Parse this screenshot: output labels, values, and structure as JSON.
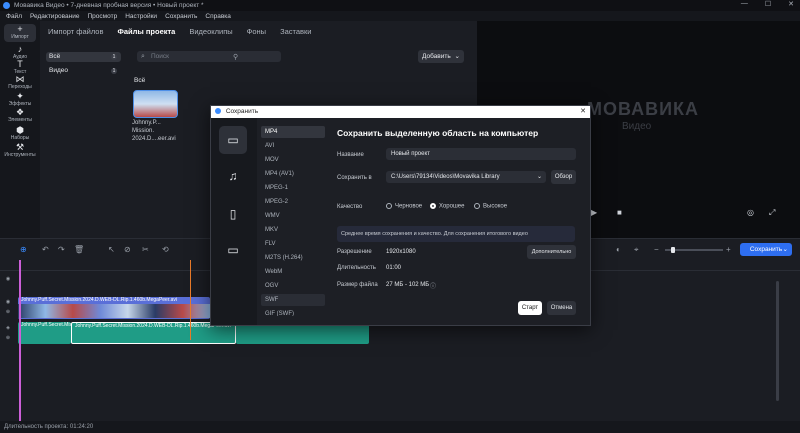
{
  "app": {
    "title": "Мовавика Видео • 7-дневная пробная версия • Новый проект *",
    "window_controls": [
      "—",
      "☐",
      "✕"
    ],
    "menu": [
      "Файл",
      "Редактирование",
      "Просмотр",
      "Настройки",
      "Сохранить",
      "Справка"
    ]
  },
  "sidebar": {
    "items": [
      {
        "label": "Импорт",
        "icon": "+"
      },
      {
        "label": "Аудио",
        "icon": "♪"
      },
      {
        "label": "Текст",
        "icon": "T"
      },
      {
        "label": "Переходы",
        "icon": "⋈"
      },
      {
        "label": "Эффекты",
        "icon": "✦"
      },
      {
        "label": "Элементы",
        "icon": "❖"
      },
      {
        "label": "Наборы",
        "icon": "⬢"
      },
      {
        "label": "Инструменты",
        "icon": "⚒"
      }
    ]
  },
  "import_panel": {
    "tabs": [
      "Импорт файлов",
      "Файлы проекта",
      "Видеоклипы",
      "Фоны",
      "Заставки"
    ],
    "categories": [
      {
        "label": "Всё",
        "count": "1"
      },
      {
        "label": "Видео",
        "count": "1"
      }
    ],
    "search_placeholder": "Поиск",
    "add_button": "Добавить",
    "section_label": "Всё",
    "file": {
      "caption": "Johnny.P... Mission. 2024.D....eer.avi"
    }
  },
  "preview": {
    "watermark_brand": "МОВАВИКА",
    "watermark_sub": "Видео"
  },
  "timeline": {
    "save_button": "Сохранить",
    "track_video_label": "Johnny.Puff.Secret.Mission.2024.D.WEB-DL.Rip.1.460b.MegaPeer.avi",
    "track_audio_label1": "Johnny.Puff.Secret.Mis",
    "track_audio_label2": "Johnny.Puff.Secret.Mission.2024.D.WEB-DL.Rip.1.460b.MegaPeer.avi",
    "status": "Длительность проекта: 01:24:20"
  },
  "dialog": {
    "title": "Сохранить",
    "close": "✕",
    "heading": "Сохранить выделенную область на компьютер",
    "formats": [
      "MP4",
      "AVI",
      "MOV",
      "MP4 (AV1)",
      "MPEG-1",
      "MPEG-2",
      "WMV",
      "MKV",
      "FLV",
      "M2TS (H.264)",
      "WebM",
      "OGV",
      "SWF",
      "GIF (SWF)"
    ],
    "selected_format": "MP4",
    "name_label": "Название",
    "name_value": "Новый проект",
    "save_in_label": "Сохранить в",
    "save_in_value": "C:\\Users\\79134\\Videos\\Movavika Library",
    "browse": "Обзор",
    "quality_label": "Качество",
    "quality_options": [
      "Черновое",
      "Хорошее",
      "Высокое"
    ],
    "quality_selected": "Хорошее",
    "hint": "Среднее время сохранения и качество. Для сохранения итогового видео",
    "resolution_label": "Разрешение",
    "resolution_value": "1920x1080",
    "advanced": "Дополнительно",
    "duration_label": "Длительность",
    "duration_value": "01:00",
    "filesize_label": "Размер файла",
    "filesize_value": "27 МБ - 102 МБ",
    "start": "Старт",
    "cancel": "Отмена"
  },
  "colors": {
    "accent": "#2e6ef0",
    "playhead": "#cc5fd8",
    "video_track": "#5a6fd8",
    "audio_track": "#1f9c86"
  }
}
